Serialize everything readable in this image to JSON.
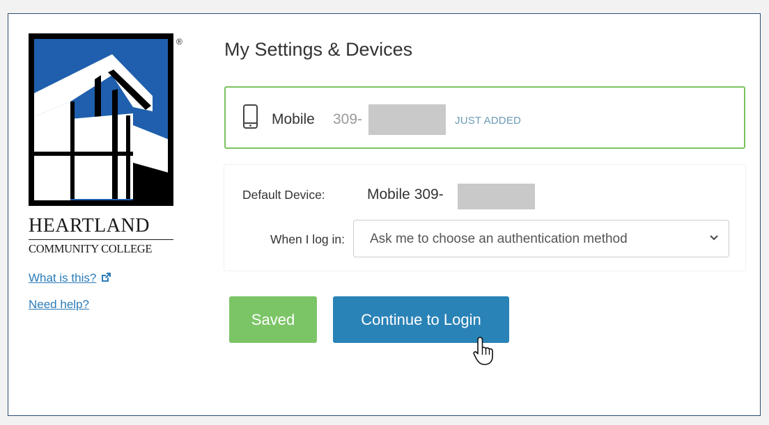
{
  "logo": {
    "name": "HEARTLAND",
    "sub": "COMMUNITY COLLEGE",
    "registered": "®",
    "colors": {
      "blue": "#1f5fad",
      "black": "#000000",
      "white": "#ffffff"
    }
  },
  "links": {
    "what_is_this": "What is this?",
    "need_help": "Need help?"
  },
  "page": {
    "title": "My Settings & Devices"
  },
  "device": {
    "icon": "mobile-phone-icon",
    "type": "Mobile",
    "number_prefix": "309-",
    "badge": "JUST ADDED",
    "border_color": "#7ac35e"
  },
  "defaults": {
    "default_device_label": "Default Device:",
    "default_device_value": "Mobile 309-",
    "when_login_label": "When I log in:",
    "when_login_selected": "Ask me to choose an authentication method"
  },
  "buttons": {
    "saved": "Saved",
    "continue": "Continue to Login",
    "saved_color": "#7cc567",
    "continue_color": "#2a83b7"
  }
}
